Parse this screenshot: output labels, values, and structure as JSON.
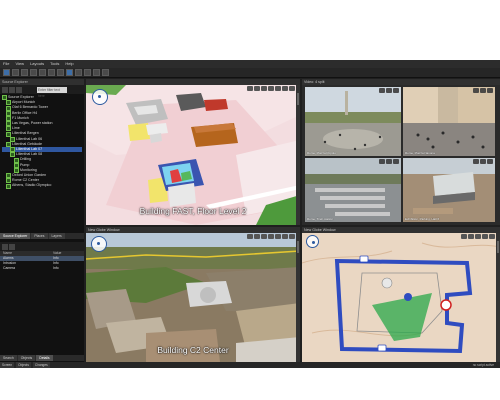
{
  "menu": [
    "File",
    "View",
    "Layouts",
    "Tools",
    "Help"
  ],
  "left_panel": {
    "title": "Source Explorer",
    "search_placeholder": "Enter filter text here",
    "tree": [
      {
        "label": "Source Explorer",
        "level": 0
      },
      {
        "label": "Airport Munich",
        "level": 1
      },
      {
        "label": "Olaf 6 Bernardo Tower",
        "level": 1
      },
      {
        "label": "Berlin Office H4",
        "level": 1
      },
      {
        "label": "F1 Munich",
        "level": 1
      },
      {
        "label": "Las Vegas, Power station",
        "level": 1
      },
      {
        "label": "Lime",
        "level": 1
      },
      {
        "label": "Lilienthal Bergen",
        "level": 1
      },
      {
        "label": "Lilienthal Lab 06",
        "level": 2
      },
      {
        "label": "Lilienthal Gebäude",
        "level": 1
      },
      {
        "label": "Lilienthal Lab 07",
        "level": 2
      },
      {
        "label": "Lilienthal Lab 08",
        "level": 2
      },
      {
        "label": "Drilling",
        "level": 3
      },
      {
        "label": "Pump",
        "level": 3
      },
      {
        "label": "Monitoring",
        "level": 3
      },
      {
        "label": "Oxford Union Garden",
        "level": 1
      },
      {
        "label": "Rome C2 Center",
        "level": 1
      },
      {
        "label": "Athens, Stadio Olympico",
        "level": 1
      }
    ],
    "tabs": [
      "Source Explorer",
      "Places",
      "Layers"
    ],
    "table_header": [
      "Name",
      "Value"
    ],
    "table_rows": [
      {
        "name": "Alarms",
        "value": "Info"
      },
      {
        "name": "Intrusion",
        "value": "Info"
      },
      {
        "name": "Camera",
        "value": "Info"
      }
    ],
    "bottom_tabs": [
      "Search",
      "Objects",
      "Details"
    ]
  },
  "views": {
    "tl": {
      "title": "",
      "caption": "Building FAST, Floor Level 2"
    },
    "tr": {
      "title": "Video: 4 split",
      "cameras": [
        {
          "label": "Rome, Piazza Popolo"
        },
        {
          "label": "Rome, Piazza Navona"
        },
        {
          "label": "Rome, Train station"
        },
        {
          "label": "Exhibition, Parking, Hall 6"
        }
      ]
    },
    "bl": {
      "title": "New Globe Window",
      "caption": "Building C2 Center"
    },
    "br": {
      "title": "New Globe Window"
    }
  },
  "status": {
    "tabs": [
      "Screen",
      "Objects",
      "Changes"
    ],
    "right": "no script active"
  }
}
